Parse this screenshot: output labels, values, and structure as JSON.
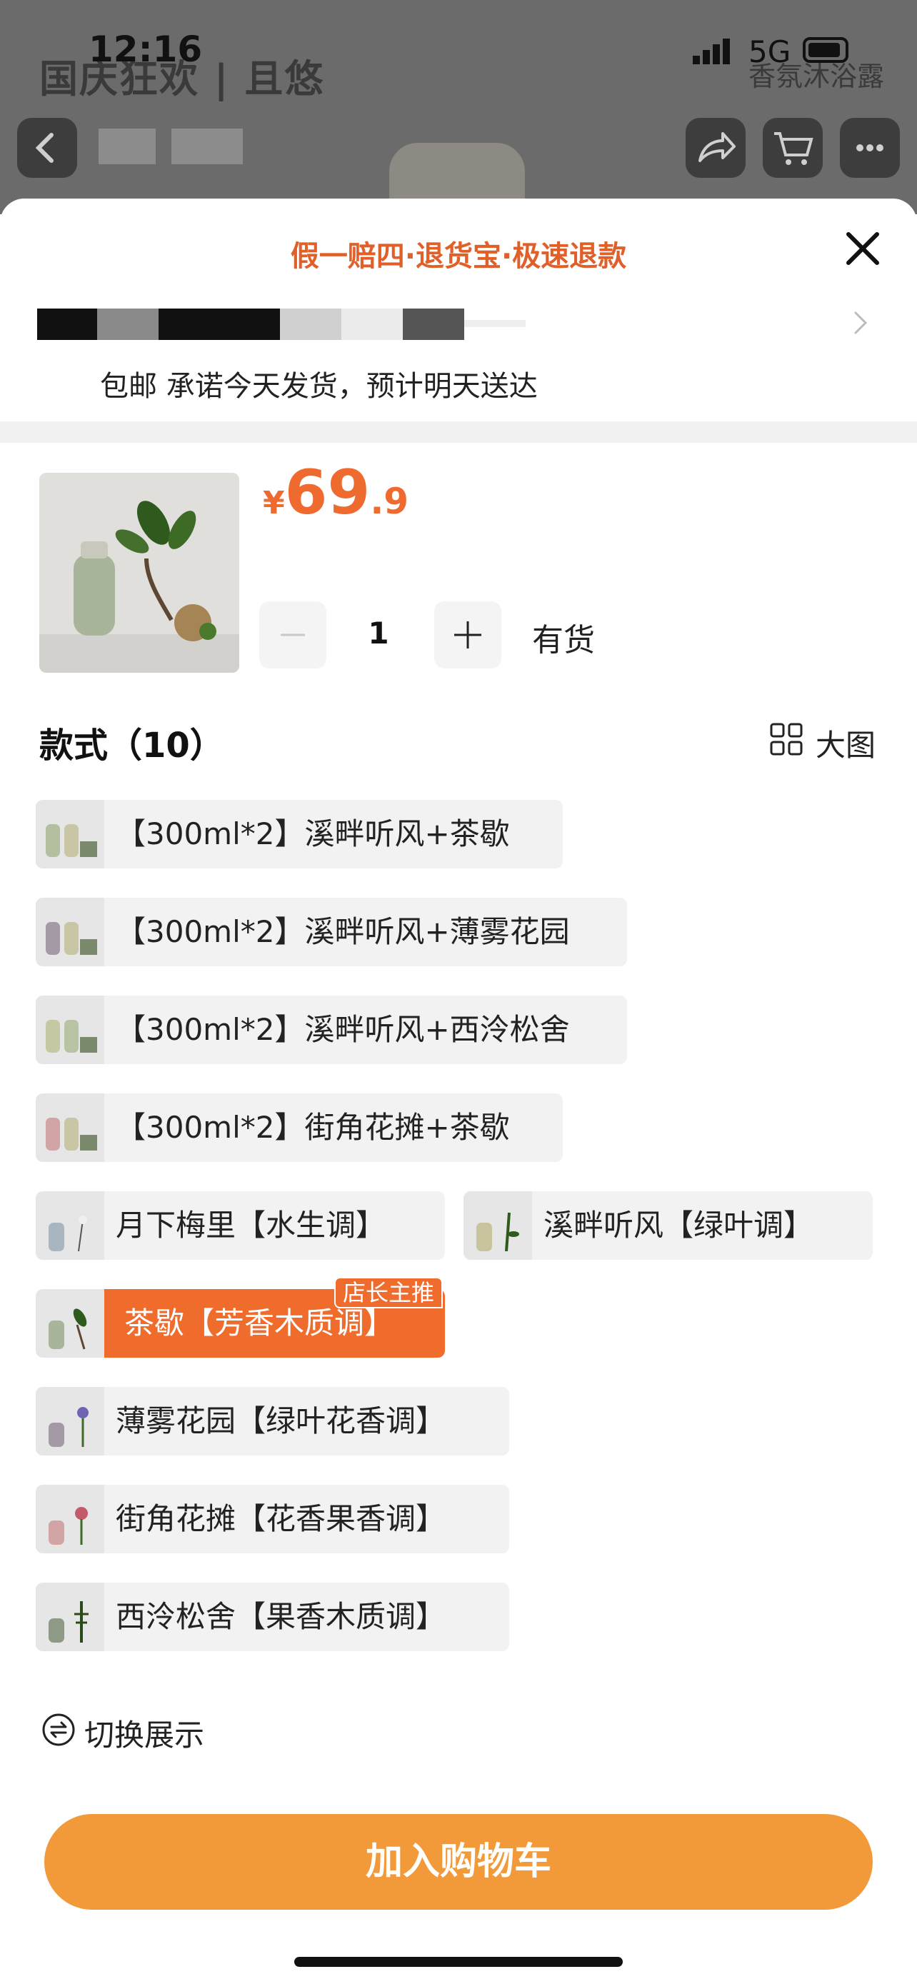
{
  "status_bar": {
    "time": "12:16",
    "network": "5G"
  },
  "background_page": {
    "logo_text": "国庆狂欢 | 且悠",
    "subtitle": "香氛沐浴露"
  },
  "sheet": {
    "promo": "假一赔四·退货宝·极速退款",
    "shipping": "包邮 承诺今天发货，预计明天送达",
    "price": {
      "currency": "¥",
      "integer": "69",
      "decimal": ".9"
    },
    "quantity": "1",
    "stock": "有货",
    "styles_title": "款式（10）",
    "big_view_label": "大图",
    "options": [
      {
        "label": "【300ml*2】溪畔听风+茶歇"
      },
      {
        "label": "【300ml*2】溪畔听风+薄雾花园"
      },
      {
        "label": "【300ml*2】溪畔听风+西泠松舍"
      },
      {
        "label": "【300ml*2】街角花摊+茶歇"
      },
      {
        "label": "月下梅里【水生调】"
      },
      {
        "label": "溪畔听风【绿叶调】"
      },
      {
        "label": "茶歇【芳香木质调】",
        "badge": "店长主推",
        "selected": true
      },
      {
        "label": "薄雾花园【绿叶花香调】"
      },
      {
        "label": "街角花摊【花香果香调】"
      },
      {
        "label": "西泠松舍【果香木质调】"
      }
    ],
    "switch_display": "切换展示",
    "add_to_cart": "加入购物车"
  },
  "colors": {
    "accent": "#f06c2d",
    "cart_button": "#f29a3a"
  }
}
